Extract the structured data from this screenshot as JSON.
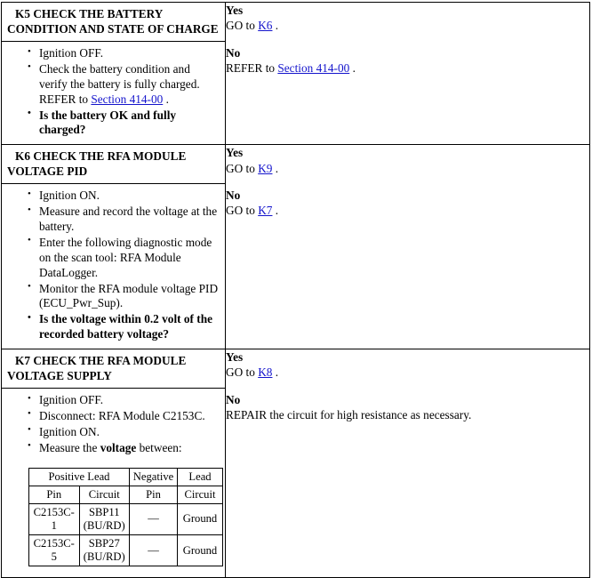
{
  "document": {
    "type": "pinpoint-test",
    "link_color": "#1414cc"
  },
  "steps": [
    {
      "id": "K5",
      "title": "K5 CHECK THE BATTERY CONDITION AND STATE OF CHARGE",
      "items": [
        {
          "text": "Ignition OFF.",
          "bold": false
        },
        {
          "text": "Check the battery condition and verify the battery is fully charged. REFER to ",
          "link": "Section 414-00",
          "tail": " .",
          "bold": false
        },
        {
          "text": "Is the battery OK and fully charged?",
          "bold": true
        }
      ],
      "yes_label": "Yes",
      "yes_prefix": "GO to ",
      "yes_link": "K6",
      "yes_tail": " .",
      "no_label": "No",
      "no_prefix": "REFER to ",
      "no_link": "Section 414-00",
      "no_tail": " ."
    },
    {
      "id": "K6",
      "title": "K6 CHECK THE RFA MODULE VOLTAGE PID",
      "items": [
        {
          "text": "Ignition ON.",
          "bold": false
        },
        {
          "text": "Measure and record the voltage at the battery.",
          "bold": false
        },
        {
          "text": "Enter the following diagnostic mode on the scan tool: RFA Module DataLogger.",
          "bold": false
        },
        {
          "text": "Monitor the RFA module voltage PID (ECU_Pwr_Sup).",
          "bold": false
        },
        {
          "text": "Is the voltage within 0.2 volt of the recorded battery voltage?",
          "bold": true
        }
      ],
      "yes_label": "Yes",
      "yes_prefix": "GO to ",
      "yes_link": "K9",
      "yes_tail": " .",
      "no_label": "No",
      "no_prefix": "GO to ",
      "no_link": "K7",
      "no_tail": " ."
    },
    {
      "id": "K7",
      "title": "K7 CHECK THE RFA MODULE VOLTAGE SUPPLY",
      "items": [
        {
          "text": "Ignition OFF.",
          "bold": false
        },
        {
          "text": "Disconnect: RFA Module C2153C.",
          "bold": false
        },
        {
          "text": "Ignition ON.",
          "bold": false
        },
        {
          "text": "Measure the voltage between:",
          "bold": false,
          "bold_word": "voltage"
        }
      ],
      "yes_label": "Yes",
      "yes_prefix": "GO to ",
      "yes_link": "K8",
      "yes_tail": " .",
      "no_label": "No",
      "no_text": "REPAIR the circuit for high resistance as necessary."
    }
  ],
  "measurement_table": {
    "group_headers": {
      "positive": "Positive Lead",
      "negative": "Negative",
      "lead": "Lead"
    },
    "column_headers": {
      "pos_pin": "Pin",
      "pos_circuit": "Circuit",
      "neg_pin": "Pin",
      "neg_circuit": "Circuit"
    },
    "rows": [
      {
        "pos_pin": "C2153C-1",
        "pos_circuit": "SBP11 (BU/RD)",
        "neg_pin": "—",
        "neg_circuit": "Ground"
      },
      {
        "pos_pin": "C2153C-5",
        "pos_circuit": "SBP27 (BU/RD)",
        "neg_pin": "—",
        "neg_circuit": "Ground"
      }
    ]
  }
}
